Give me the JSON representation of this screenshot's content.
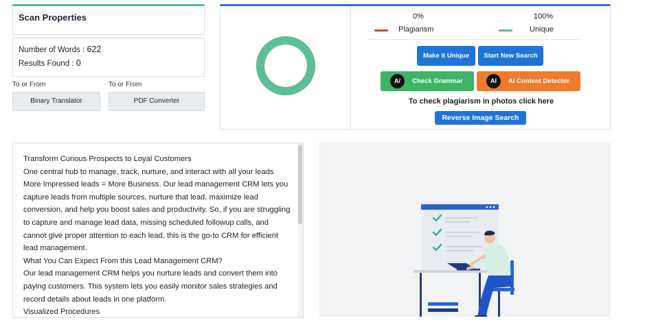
{
  "scan": {
    "title": "Scan Properties",
    "words_label": "Number of Words : ",
    "words_value": "622",
    "results_label": "Results Found : ",
    "results_value": "0"
  },
  "tools": [
    {
      "caption": "To or From",
      "label": "Binary Translator"
    },
    {
      "caption": "To or From",
      "label": "PDF Converter"
    }
  ],
  "result": {
    "plagiarism_pct": "0%",
    "unique_pct": "100%",
    "plagiarism_label": "Plagiarism",
    "unique_label": "Unique",
    "plagiarism_color": "#e03a3a",
    "unique_color": "#5bbf98",
    "plagiarism_fraction": 0.0,
    "unique_fraction": 1.0,
    "buttons": {
      "make_unique": "Make it Unique",
      "start_new": "Start New Search",
      "check_grammar": "Check Grammar",
      "ai_detector": "AI Content Detector",
      "reverse_image": "Reverse Image Search"
    },
    "badges": {
      "grammar": "A/",
      "ai": "AI"
    },
    "photo_text": "To check plagiarism in photos click here"
  },
  "text": {
    "lines": [
      "Transform Curious Prospects to Loyal Customers",
      "One central hub to manage, track, nurture, and interact with all your leads",
      "More Impressed leads = More Business. Our lead management CRM lets you capture leads from multiple sources, nurture that lead, maximize lead conversion, and help you boost sales and productivity. So, if you are struggling to capture and manage lead data, missing scheduled followup calls, and cannot give proper attention to each lead, this is the go-to CRM for efficient lead management.",
      "What You Can Expect From this Lead Management CRM?",
      "Our lead management CRM helps you nurture leads and convert them into paying customers. This system lets you easily monitor sales strategies and record details about leads in one platform.",
      "Visualized Procedures"
    ]
  }
}
